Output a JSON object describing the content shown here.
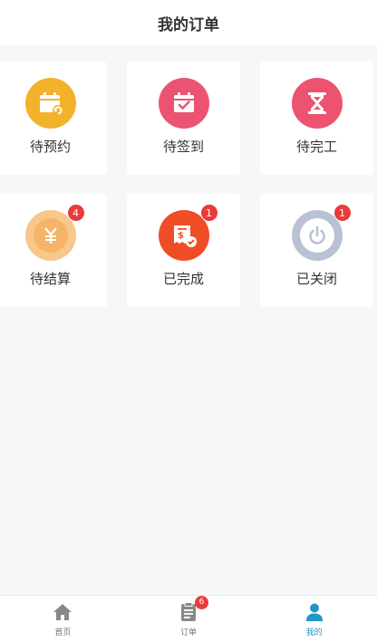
{
  "header": {
    "title": "我的订单"
  },
  "orders": [
    {
      "label": "待预约",
      "icon": "calendar-reschedule-icon",
      "color": "#f3b22b",
      "badge": null
    },
    {
      "label": "待签到",
      "icon": "calendar-check-icon",
      "color": "#ec5370",
      "badge": null
    },
    {
      "label": "待完工",
      "icon": "hourglass-icon",
      "color": "#ec5370",
      "badge": null
    },
    {
      "label": "待结算",
      "icon": "yuan-icon",
      "color": "#f7c78b",
      "badge": "4"
    },
    {
      "label": "已完成",
      "icon": "receipt-check-icon",
      "color": "#f04d26",
      "badge": "1"
    },
    {
      "label": "已关闭",
      "icon": "power-icon",
      "color": "#b8c2d4",
      "badge": "1"
    }
  ],
  "tabbar": {
    "tabs": [
      {
        "label": "首页",
        "icon": "home-icon",
        "badge": null,
        "active": false
      },
      {
        "label": "订单",
        "icon": "clipboard-icon",
        "badge": "6",
        "active": false
      },
      {
        "label": "我的",
        "icon": "person-icon",
        "badge": null,
        "active": true
      }
    ]
  },
  "colors": {
    "accent": "#2196c8",
    "badge": "#e93b3b",
    "background": "#f6f7f9"
  }
}
